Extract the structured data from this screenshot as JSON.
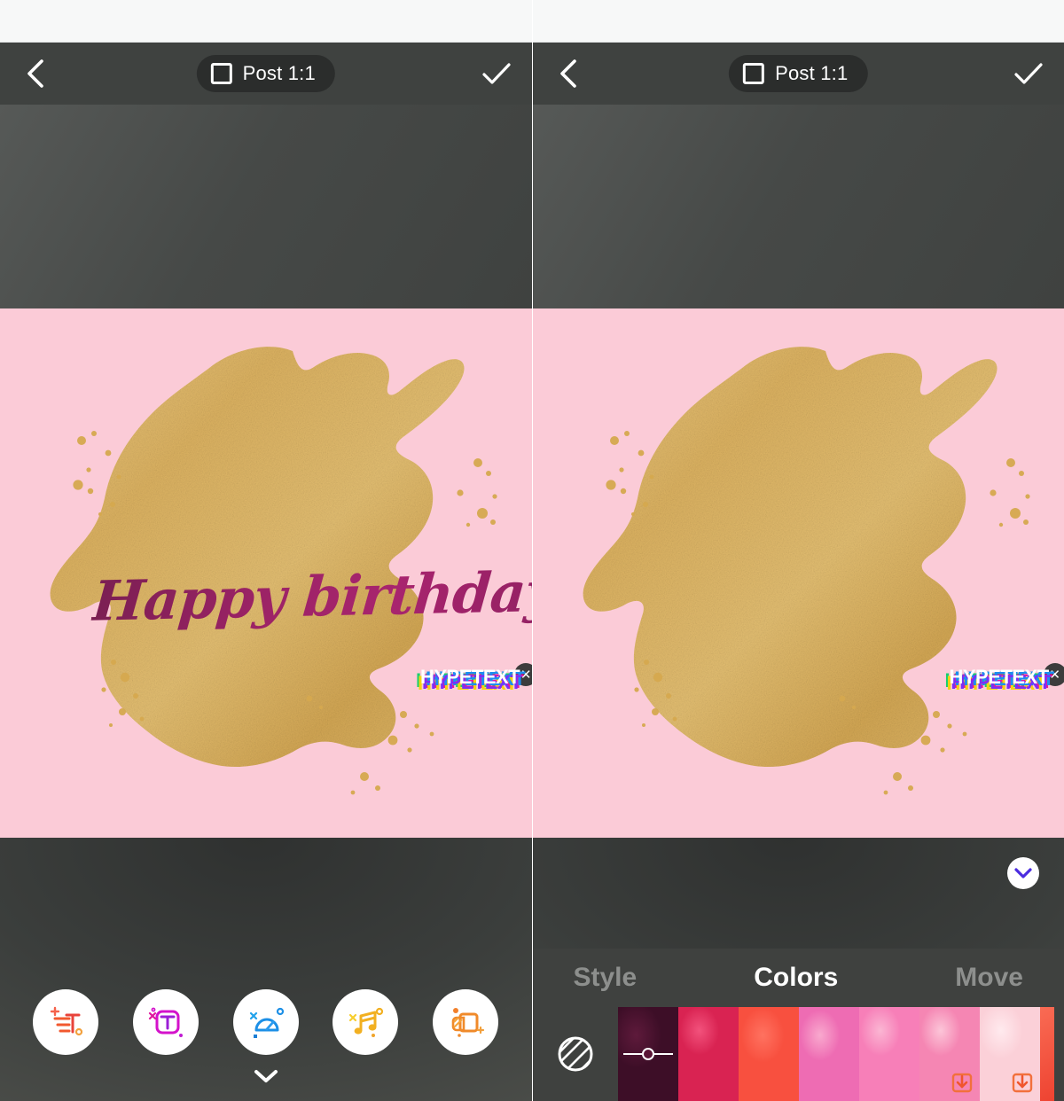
{
  "app": {
    "name": "HypeText video text editor",
    "watermark_text": "HYPETEXT",
    "close_watermark_label": "✕"
  },
  "topnav": {
    "back_icon": "chevron-left-icon",
    "confirm_icon": "check-icon",
    "ratio_label": "Post 1:1",
    "ratio_icon": "square-icon"
  },
  "canvas": {
    "background_color": "#FBCBD7",
    "artwork_text": "Happy birthday!",
    "artwork_text_color": "#9C2366",
    "blob_color": "#DDB362"
  },
  "toolbar": {
    "items": [
      {
        "name": "add-text-tool",
        "icon": "add-text-icon",
        "color": "#F2582E"
      },
      {
        "name": "text-style-tool",
        "icon": "text-box-icon",
        "color": "#D412CB"
      },
      {
        "name": "speed-tool",
        "icon": "speedometer-icon",
        "color": "#1C8FE6"
      },
      {
        "name": "music-tool",
        "icon": "music-note-icon",
        "color": "#F2B021"
      },
      {
        "name": "layers-tool",
        "icon": "layers-add-icon",
        "color": "#F08A2A"
      }
    ],
    "collapse_icon": "chevron-down-icon"
  },
  "editor": {
    "collapse_icon": "chevron-down-icon",
    "tabs": [
      {
        "label": "Style",
        "active": false
      },
      {
        "label": "Colors",
        "active": true
      },
      {
        "label": "Move",
        "active": false
      }
    ],
    "no_color": {
      "name": "no-color-swatch",
      "icon": "hatched-circle-icon"
    },
    "swatches": [
      {
        "name": "swatch-dark-maroon",
        "color": "#4E1330",
        "selected": true,
        "locked": false
      },
      {
        "name": "swatch-crimson",
        "color": "#E8305E",
        "selected": false,
        "locked": false
      },
      {
        "name": "swatch-coral-red",
        "color": "#F85040",
        "selected": false,
        "locked": false
      },
      {
        "name": "swatch-magenta",
        "color": "#ED5FB0",
        "selected": false,
        "locked": false
      },
      {
        "name": "swatch-hot-pink",
        "color": "#F56BB0",
        "selected": false,
        "locked": false
      },
      {
        "name": "swatch-pink",
        "color": "#F472A6",
        "selected": false,
        "locked": true
      },
      {
        "name": "swatch-light-pink",
        "color": "#F9C4CC",
        "selected": false,
        "locked": true
      },
      {
        "name": "swatch-red-edge",
        "color": "#F4513F",
        "selected": false,
        "locked": false
      }
    ],
    "download_icon": "download-icon"
  }
}
